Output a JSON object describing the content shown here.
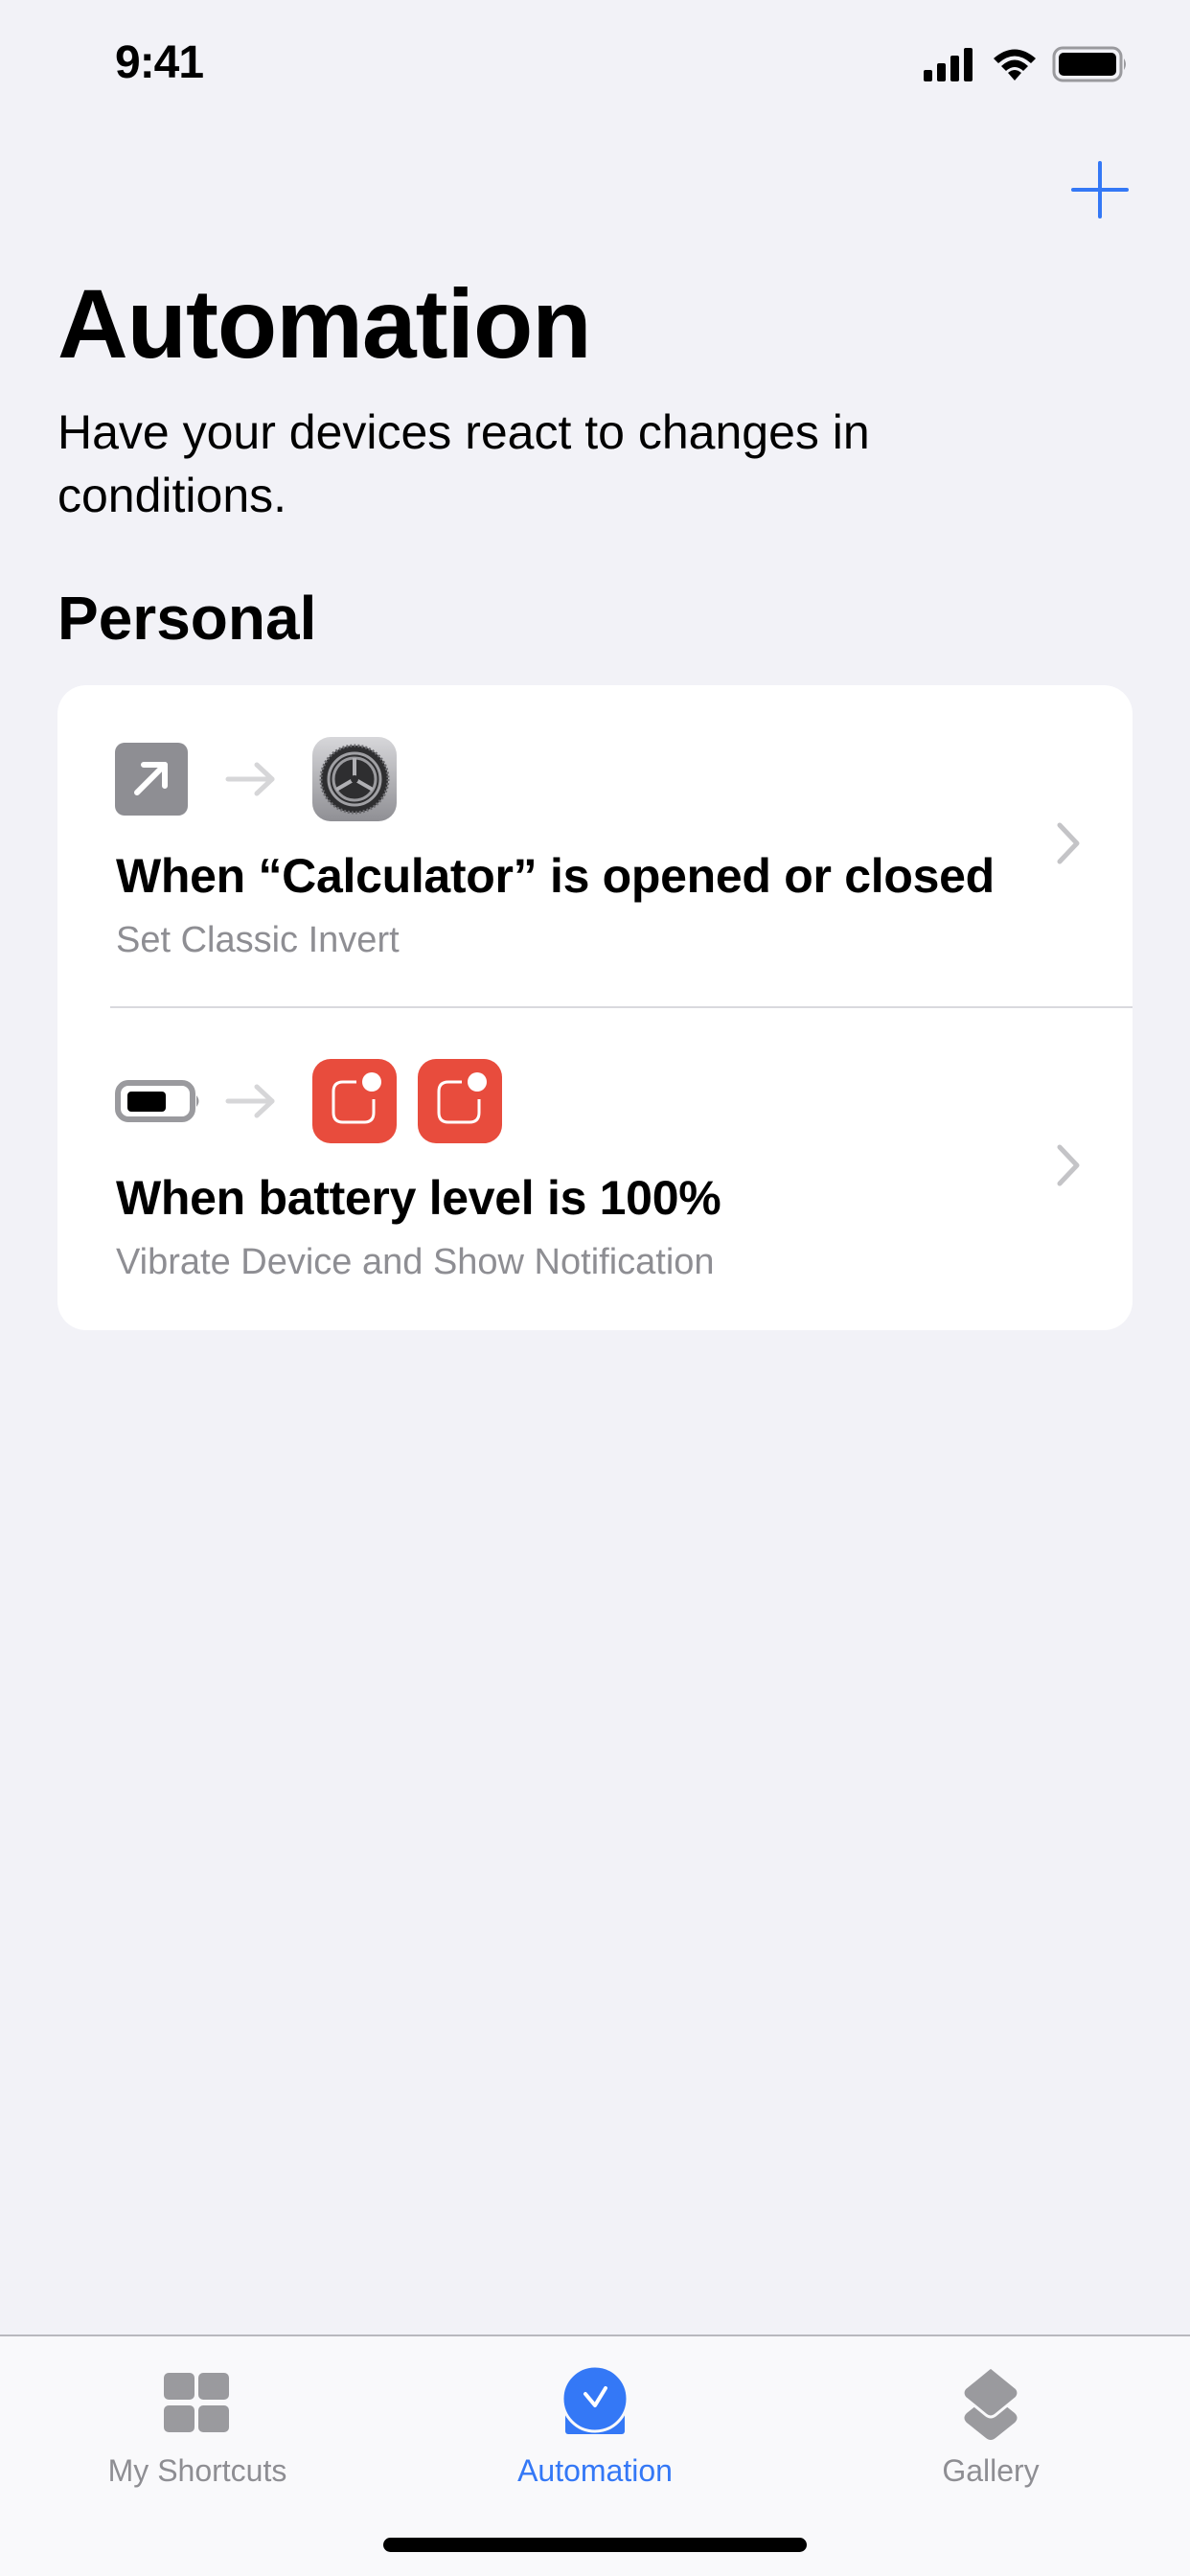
{
  "status_bar": {
    "time": "9:41"
  },
  "header": {
    "add_button_icon": "plus-icon",
    "title": "Automation",
    "subtitle": "Have your devices react to changes in conditions."
  },
  "sections": [
    {
      "title": "Personal",
      "automations": [
        {
          "trigger_icon": "app-open-arrow-icon",
          "action_icons": [
            "settings-gear-icon"
          ],
          "title": "When “Calculator” is opened or closed",
          "subtitle": "Set Classic Invert"
        },
        {
          "trigger_icon": "battery-icon",
          "action_icons": [
            "notification-icon",
            "notification-icon"
          ],
          "title": "When battery level is 100%",
          "subtitle": "Vibrate Device and Show Notification"
        }
      ]
    }
  ],
  "tab_bar": {
    "tabs": [
      {
        "label": "My Shortcuts",
        "icon": "grid-icon",
        "active": false
      },
      {
        "label": "Automation",
        "icon": "automation-check-icon",
        "active": true
      },
      {
        "label": "Gallery",
        "icon": "gallery-layers-icon",
        "active": false
      }
    ]
  },
  "colors": {
    "accent": "#3478f6",
    "background": "#f2f2f7",
    "secondary_text": "#8e8e93",
    "notification_red": "#e84c3d"
  }
}
